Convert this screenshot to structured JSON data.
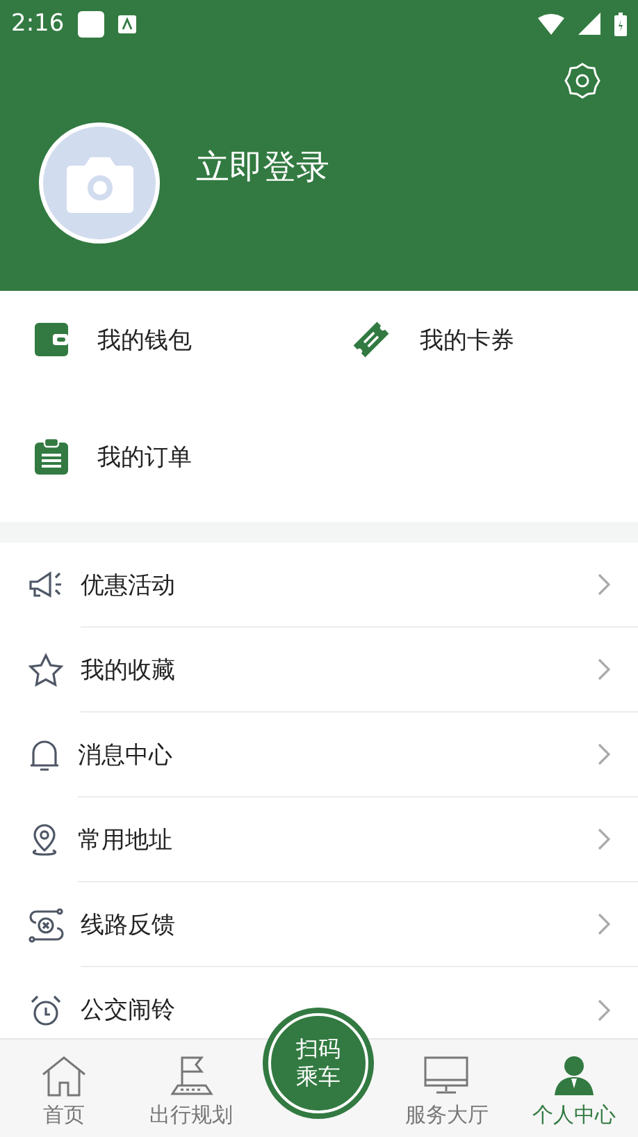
{
  "status_bar": {
    "time": "2:16"
  },
  "profile": {
    "login_label": "立即登录"
  },
  "quick_links": [
    {
      "label": "我的钱包",
      "kind": "wallet"
    },
    {
      "label": "我的卡券",
      "kind": "ticket"
    },
    {
      "label": "我的订单",
      "kind": "clipboard"
    }
  ],
  "menu": [
    {
      "label": "优惠活动",
      "kind": "megaphone"
    },
    {
      "label": "我的收藏",
      "kind": "star"
    },
    {
      "label": "消息中心",
      "kind": "bell"
    },
    {
      "label": "常用地址",
      "kind": "pin"
    },
    {
      "label": "线路反馈",
      "kind": "route"
    },
    {
      "label": "公交闹铃",
      "kind": "alarm"
    }
  ],
  "tab_bar": {
    "tabs": [
      {
        "label": "首页",
        "kind": "home",
        "selected": false
      },
      {
        "label": "出行规划",
        "kind": "flag",
        "selected": false
      },
      {
        "label": "服务大厅",
        "kind": "monitor",
        "selected": false
      },
      {
        "label": "个人中心",
        "kind": "person",
        "selected": true
      }
    ],
    "scan_button": {
      "lines": [
        "扫码",
        "乘车"
      ]
    }
  }
}
